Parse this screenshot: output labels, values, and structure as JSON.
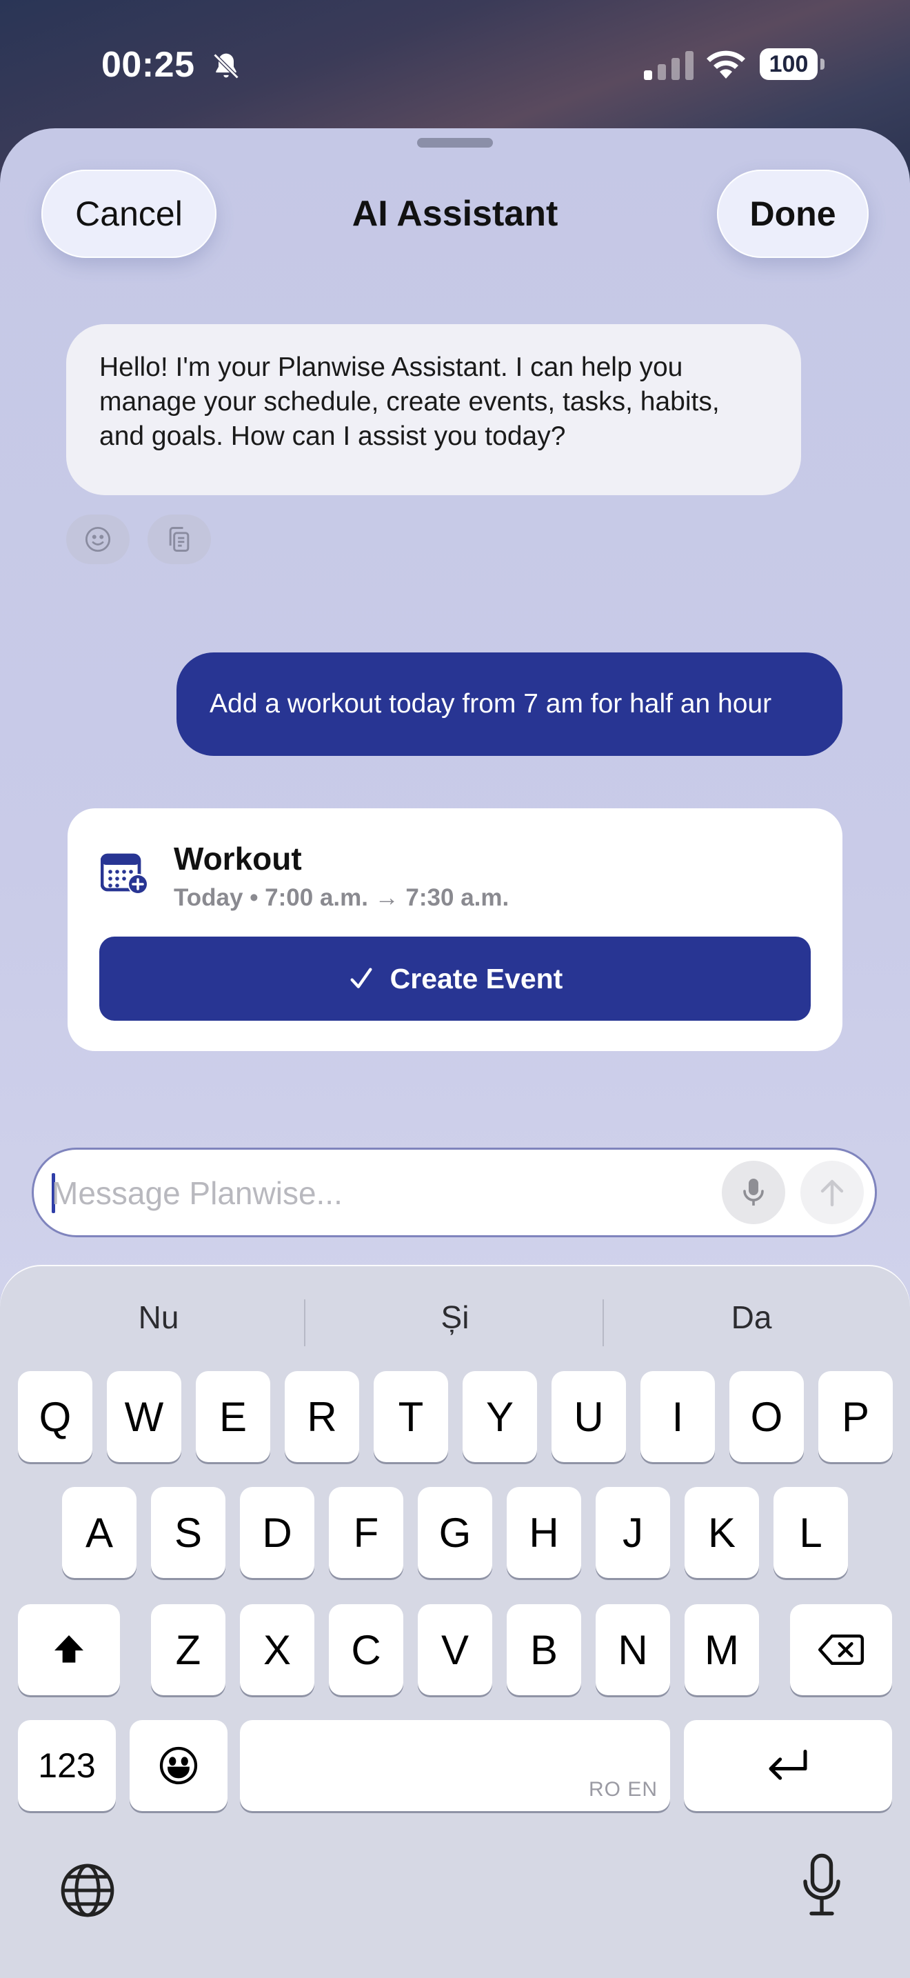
{
  "status_bar": {
    "time": "00:25",
    "battery": "100"
  },
  "header": {
    "cancel_label": "Cancel",
    "title": "AI Assistant",
    "done_label": "Done"
  },
  "messages": {
    "assistant_greeting": "Hello! I'm your Planwise Assistant. I can help you manage your schedule, create events, tasks, habits, and goals. How can I assist you today?",
    "user_request": "Add a workout today from 7 am for half an hour"
  },
  "event_card": {
    "title": "Workout",
    "meta": "Today • 7:00 a.m. → 7:30 a.m.",
    "create_label": "Create Event"
  },
  "composer": {
    "placeholder": "Message Planwise..."
  },
  "keyboard": {
    "suggestions": [
      "Nu",
      "Și",
      "Da"
    ],
    "row1": [
      "Q",
      "W",
      "E",
      "R",
      "T",
      "Y",
      "U",
      "I",
      "O",
      "P"
    ],
    "row2": [
      "A",
      "S",
      "D",
      "F",
      "G",
      "H",
      "J",
      "K",
      "L"
    ],
    "row3": [
      "Z",
      "X",
      "C",
      "V",
      "B",
      "N",
      "M"
    ],
    "numbers_label": "123",
    "space_label": "RO EN"
  },
  "colors": {
    "accent": "#283593",
    "sheet_bg": "#c9cbe8",
    "bubble_bg": "#f0f0f6"
  }
}
